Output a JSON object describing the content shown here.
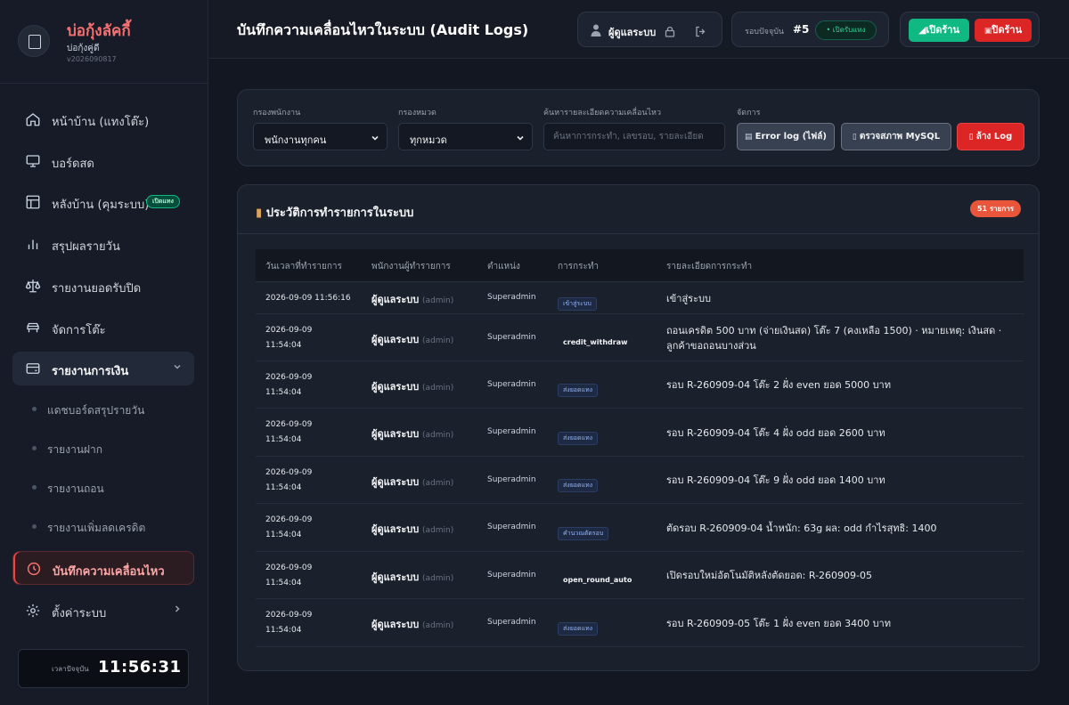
{
  "brand": {
    "name": "บ่อกุ้งลัคกี้",
    "sub": "บ่อกุ้งคู่ดี",
    "version": "v2026090817"
  },
  "nav": {
    "items": [
      {
        "label": "หน้าบ้าน (แทงโต๊ะ)",
        "icon": "home-icon"
      },
      {
        "label": "บอร์ดสด",
        "icon": "monitor-icon"
      },
      {
        "label": "หลังบ้าน (คุมระบบ)",
        "icon": "layout-icon",
        "badge": "เปิดแทง"
      },
      {
        "label": "สรุปผลรายวัน",
        "icon": "bar-chart-icon"
      },
      {
        "label": "รายงานยอดรับปิด",
        "icon": "scale-icon"
      },
      {
        "label": "จัดการโต๊ะ",
        "icon": "table-icon"
      },
      {
        "label": "รายงานการเงิน",
        "icon": "wallet-icon"
      }
    ],
    "finance_sub": [
      {
        "label": "แดชบอร์ดสรุปรายวัน"
      },
      {
        "label": "รายงานฝาก"
      },
      {
        "label": "รายงานถอน"
      },
      {
        "label": "รายงานเพิ่มลดเครดิต"
      }
    ],
    "active_label": "บันทึกความเคลื่อนไหว",
    "settings_label": "ตั้งค่าระบบ"
  },
  "clock": {
    "label": "เวลาปัจจุบัน",
    "time": "11:56:31"
  },
  "header": {
    "title": "บันทึกความเคลื่อนไหวในระบบ (Audit Logs)",
    "user": "ผู้ดูแลระบบ",
    "round_label": "รอบปัจจุบัน",
    "round_number": "#5",
    "round_status": "• เปิดรับแทง",
    "open_shop": "เปิดร้าน",
    "close_shop": "ปิดร้าน"
  },
  "filters": {
    "staff_label": "กรองพนักงาน",
    "staff_value": "พนักงานทุกคน",
    "category_label": "กรองหมวด",
    "category_value": "ทุกหมวด",
    "search_label": "ค้นหารายละเอียดความเคลื่อนไหว",
    "search_placeholder": "ค้นหาการกระทำ, เลขรอบ, รายละเอียด",
    "manage_label": "จัดการ",
    "error_log_button": "Error log (ไฟล์)",
    "mysql_button": "ตรวจสภาพ MySQL",
    "clear_button": "ล้าง Log"
  },
  "history": {
    "title": "ประวัติการทำรายการในระบบ",
    "count": "51 รายการ",
    "columns": [
      "วันเวลาที่ทำรายการ",
      "พนักงานผู้ทำรายการ",
      "ตำแหน่ง",
      "การกระทำ",
      "รายละเอียดการกระทำ"
    ],
    "rows": [
      {
        "date": "2026-09-09 11:56:16",
        "time": "",
        "user": "ผู้ดูแลระบบ",
        "username": "(admin)",
        "role": "Superadmin",
        "action": "เข้าสู่ระบบ",
        "action_style": "pill",
        "detail": "เข้าสู่ระบบ"
      },
      {
        "date": "2026-09-09",
        "time": "11:54:04",
        "user": "ผู้ดูแลระบบ",
        "username": "(admin)",
        "role": "Superadmin",
        "action": "credit_withdraw",
        "action_style": "plain",
        "detail": "ถอนเครดิต 500 บาท (จ่ายเงินสด) โต๊ะ 7 (คงเหลือ 1500) · หมายเหตุ: เงินสด · ลูกค้าขอถอนบางส่วน"
      },
      {
        "date": "2026-09-09",
        "time": "11:54:04",
        "user": "ผู้ดูแลระบบ",
        "username": "(admin)",
        "role": "Superadmin",
        "action": "ส่งยอดแทง",
        "action_style": "pill",
        "detail": "รอบ R-260909-04 โต๊ะ 2 ฝั่ง even ยอด 5000 บาท"
      },
      {
        "date": "2026-09-09",
        "time": "11:54:04",
        "user": "ผู้ดูแลระบบ",
        "username": "(admin)",
        "role": "Superadmin",
        "action": "ส่งยอดแทง",
        "action_style": "pill",
        "detail": "รอบ R-260909-04 โต๊ะ 4 ฝั่ง odd ยอด 2600 บาท"
      },
      {
        "date": "2026-09-09",
        "time": "11:54:04",
        "user": "ผู้ดูแลระบบ",
        "username": "(admin)",
        "role": "Superadmin",
        "action": "ส่งยอดแทง",
        "action_style": "pill",
        "detail": "รอบ R-260909-04 โต๊ะ 9 ฝั่ง odd ยอด 1400 บาท"
      },
      {
        "date": "2026-09-09",
        "time": "11:54:04",
        "user": "ผู้ดูแลระบบ",
        "username": "(admin)",
        "role": "Superadmin",
        "action": "คำนวณตัดรอบ",
        "action_style": "pill",
        "detail": "ตัดรอบ R-260909-04 น้ำหนัก: 63g ผล: odd กำไรสุทธิ: 1400"
      },
      {
        "date": "2026-09-09",
        "time": "11:54:04",
        "user": "ผู้ดูแลระบบ",
        "username": "(admin)",
        "role": "Superadmin",
        "action": "open_round_auto",
        "action_style": "plain",
        "detail": "เปิดรอบใหม่อัตโนมัติหลังตัดยอด: R-260909-05"
      },
      {
        "date": "2026-09-09",
        "time": "11:54:04",
        "user": "ผู้ดูแลระบบ",
        "username": "(admin)",
        "role": "Superadmin",
        "action": "ส่งยอดแทง",
        "action_style": "pill",
        "detail": "รอบ R-260909-05 โต๊ะ 1 ฝั่ง even ยอด 3400 บาท"
      }
    ]
  },
  "colors": {
    "accent_red": "#ef4444",
    "accent_green": "#10b981",
    "background": "#131722"
  }
}
